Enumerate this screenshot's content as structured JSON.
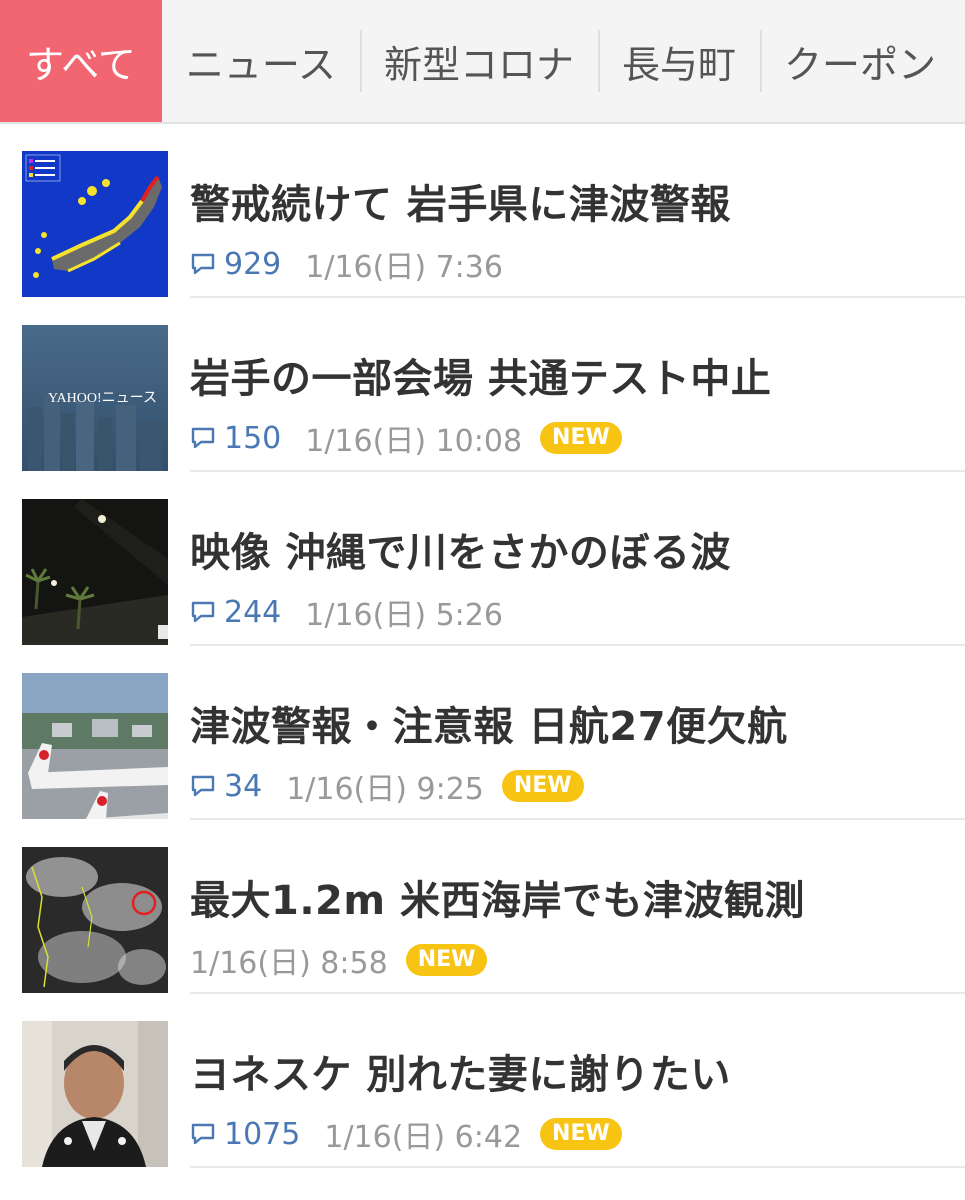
{
  "tabs": [
    {
      "label": "すべて",
      "active": true
    },
    {
      "label": "ニュース"
    },
    {
      "label": "新型コロナ"
    },
    {
      "label": "長与町"
    },
    {
      "label": "クーポン"
    }
  ],
  "articles": [
    {
      "title": "警戒続けて 岩手県に津波警報",
      "comments": "929",
      "date": "1/16(日) 7:36",
      "badge": ""
    },
    {
      "title": "岩手の一部会場 共通テスト中止",
      "comments": "150",
      "date": "1/16(日) 10:08",
      "badge": "NEW",
      "thumb_text": "YAHOO!ニュース"
    },
    {
      "title": "映像 沖縄で川をさかのぼる波",
      "comments": "244",
      "date": "1/16(日) 5:26",
      "badge": ""
    },
    {
      "title": "津波警報・注意報 日航27便欠航",
      "comments": "34",
      "date": "1/16(日) 9:25",
      "badge": "NEW"
    },
    {
      "title": "最大1.2m 米西海岸でも津波観測",
      "comments": "",
      "date": "1/16(日) 8:58",
      "badge": "NEW"
    },
    {
      "title": "ヨネスケ 別れた妻に謝りたい",
      "comments": "1075",
      "date": "1/16(日) 6:42",
      "badge": "NEW"
    }
  ],
  "colors": {
    "accent": "#f26672",
    "comment_blue": "#4a78b5",
    "badge_yellow": "#f7c414"
  },
  "icons": {
    "comment": "comment-bubble-icon"
  }
}
